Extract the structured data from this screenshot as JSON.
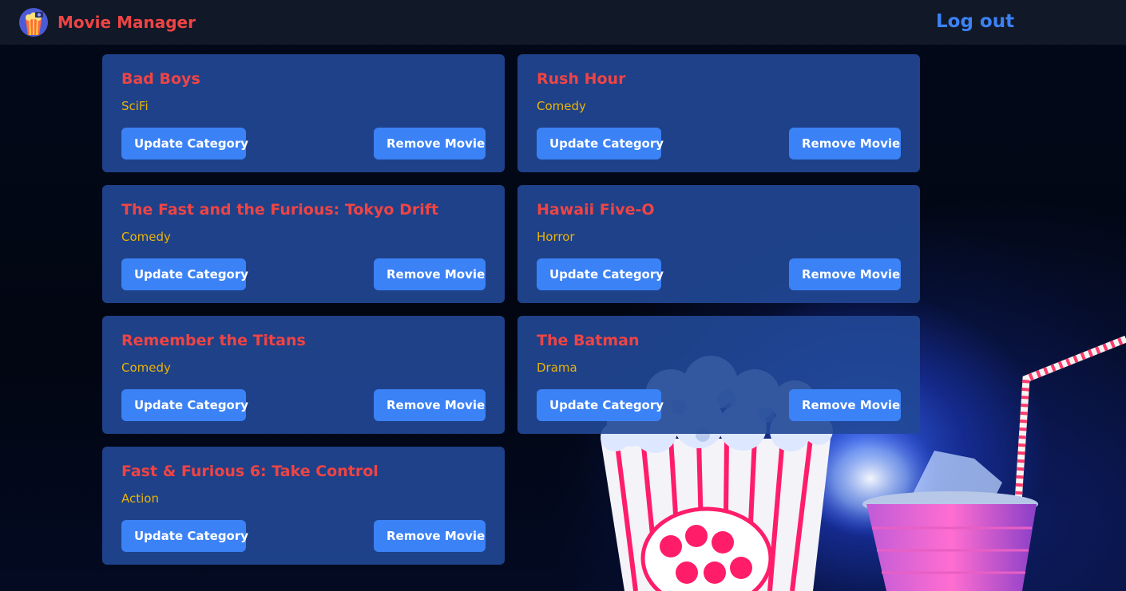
{
  "header": {
    "brand": "Movie Manager",
    "logout": "Log out"
  },
  "buttons": {
    "update": "Update Category",
    "remove": "Remove Movie"
  },
  "movies": [
    {
      "title": "Bad Boys",
      "category": "SciFi"
    },
    {
      "title": "Rush Hour",
      "category": "Comedy"
    },
    {
      "title": "The Fast and the Furious: Tokyo Drift",
      "category": "Comedy"
    },
    {
      "title": "Hawaii Five-O",
      "category": "Horror"
    },
    {
      "title": "Remember the Titans",
      "category": "Comedy"
    },
    {
      "title": "The Batman",
      "category": "Drama"
    },
    {
      "title": "Fast & Furious 6: Take Control",
      "category": "Action"
    }
  ],
  "colors": {
    "nav_bg": "#111827",
    "brand": "#ef4444",
    "logout": "#3b82f6",
    "card_bg": "#214896",
    "title": "#ef4444",
    "category": "#eab308",
    "button": "#3b82f6"
  },
  "icons": {
    "logo": "movie-popcorn-logo-icon"
  }
}
